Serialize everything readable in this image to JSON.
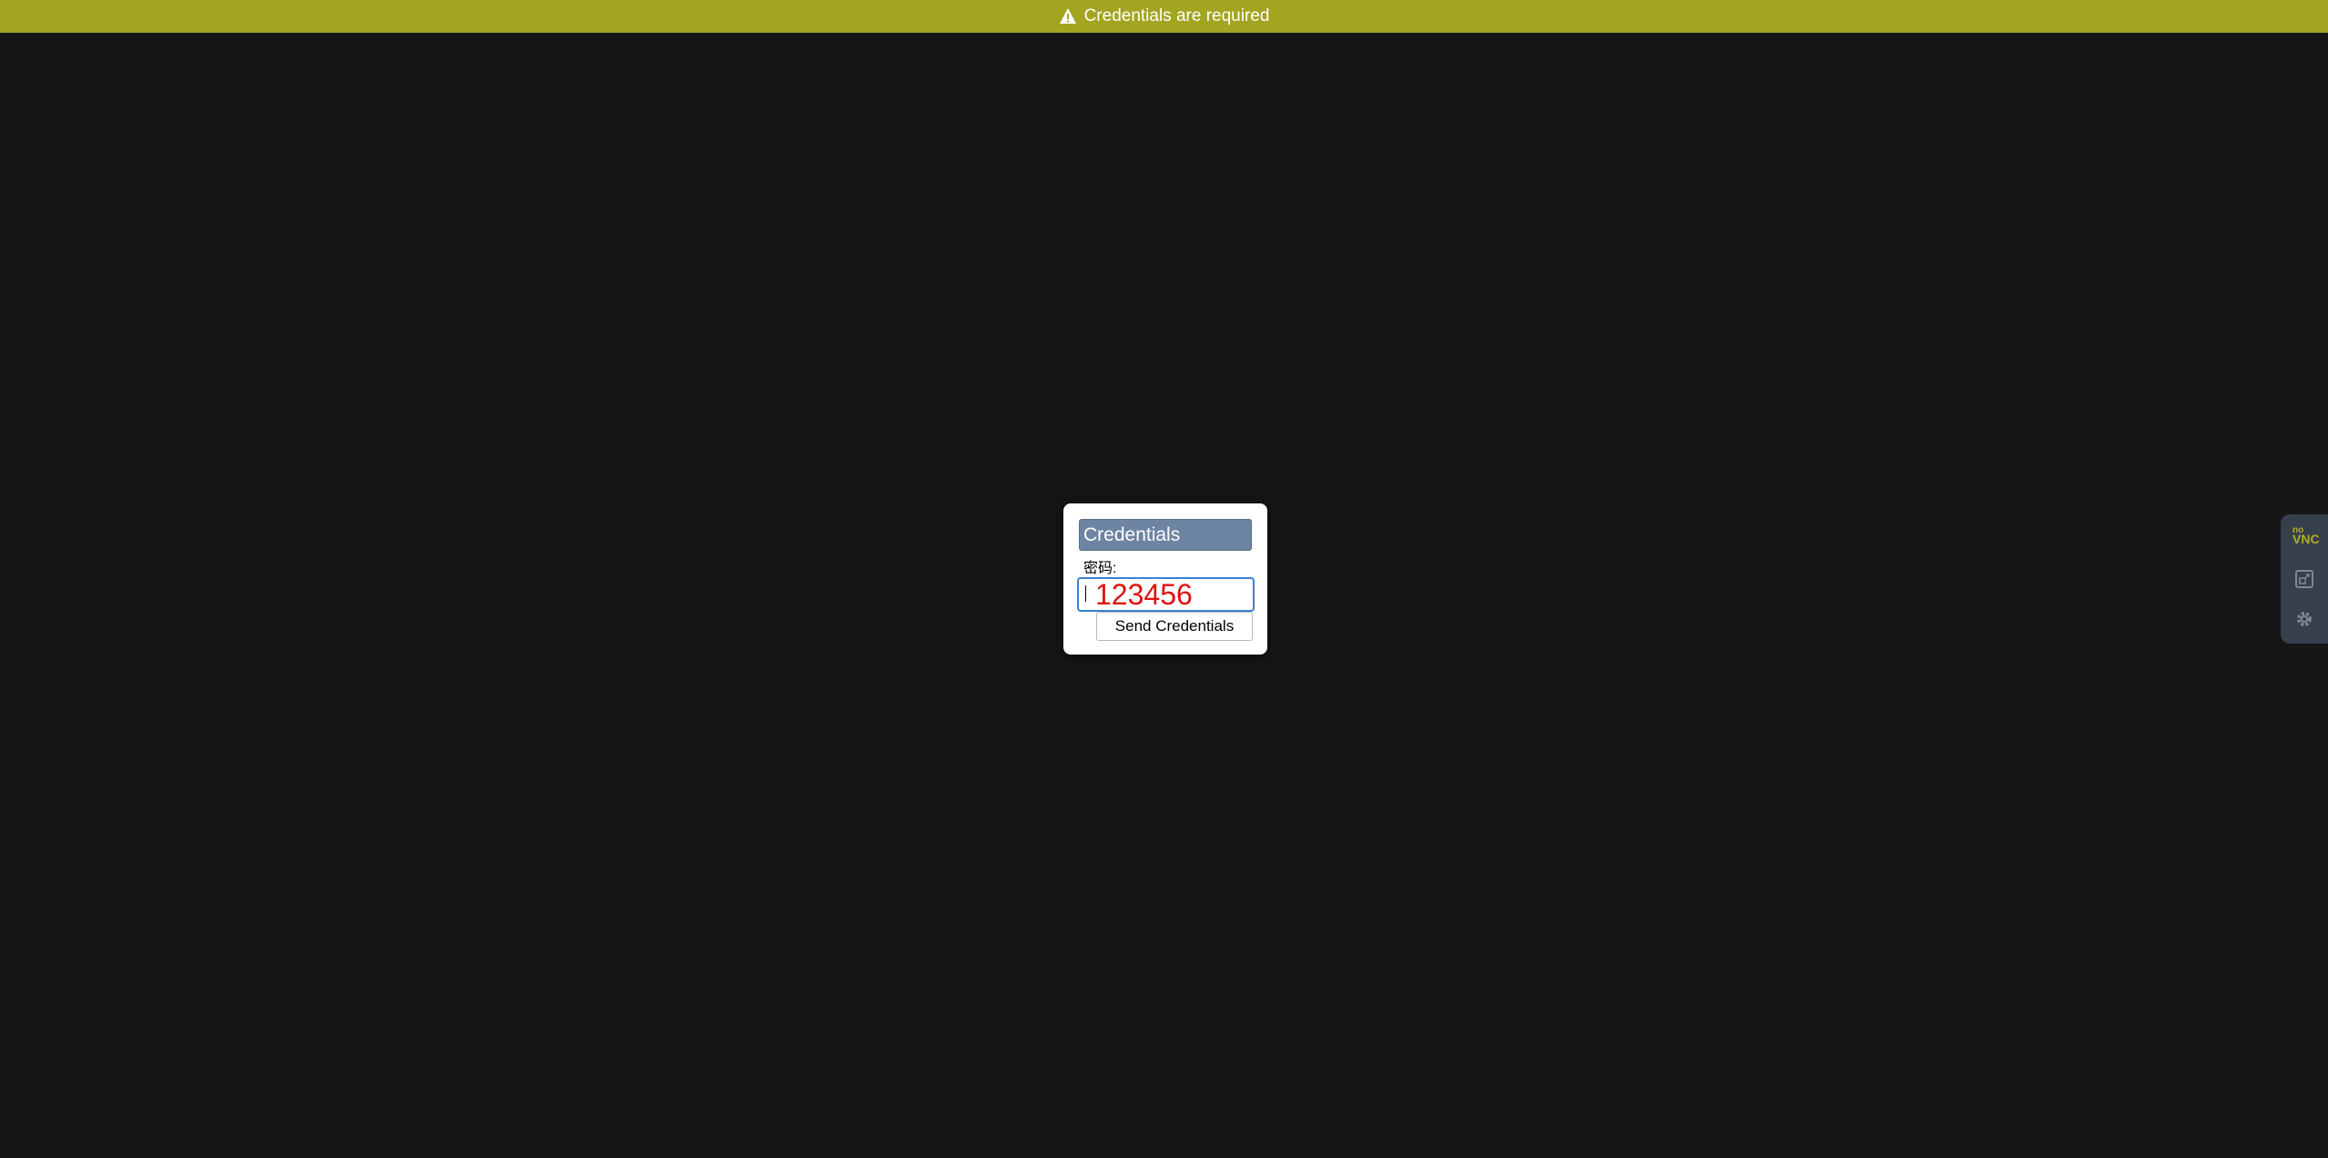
{
  "status_bar": {
    "message": "Credentials are required",
    "background": "#a3a520",
    "icon": "warning-icon"
  },
  "dialog": {
    "title": "Credentials",
    "password_label": "密码:",
    "password_value": "123456",
    "send_button_label": "Send Credentials",
    "header_color": "#6e84a3",
    "value_color": "#e01010"
  },
  "control_bar": {
    "logo_no": "no",
    "logo_vnc": "VNC",
    "logo_icon": "novnc-logo",
    "buttons": [
      "fullscreen-icon",
      "gear-icon"
    ]
  }
}
